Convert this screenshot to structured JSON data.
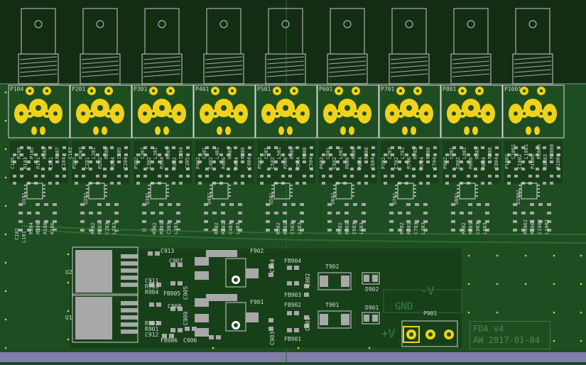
{
  "board": {
    "title_line1": "FDA v4",
    "title_line2": "AW 2017-01-04",
    "colors": {
      "background": "#132c14",
      "board": "#1e4d21",
      "copper_fill": "#174019",
      "pad": "#f0d21a",
      "smd_pad": "#a8a8a8",
      "silkscreen": "#e6e6e6",
      "edge": "#ffe600"
    }
  },
  "connectors": [
    {
      "label": "P104"
    },
    {
      "label": "P201"
    },
    {
      "label": "P301"
    },
    {
      "label": "P401"
    },
    {
      "label": "P501"
    },
    {
      "label": "P601"
    },
    {
      "label": "P701"
    },
    {
      "label": "P801"
    },
    {
      "label": "P1001"
    }
  ],
  "channels": [
    {
      "cols": [
        "C105",
        "R105",
        "R103",
        "P105",
        "R101",
        "R102",
        "C101",
        "R107",
        "C104",
        "C103"
      ],
      "u": "U101",
      "bottom": [
        "R104",
        "R109",
        "R108",
        "R106"
      ],
      "low": [
        "C102",
        "L101"
      ]
    },
    {
      "cols": [
        "P202",
        "R203",
        "C201",
        "L201",
        "R202",
        "R206",
        "R204",
        "C205",
        "C204"
      ],
      "u": "U201",
      "bottom": [
        "R202",
        "R201",
        "C203",
        "L203"
      ],
      "low": []
    },
    {
      "cols": [
        "P302",
        "C301",
        "C302",
        "L301",
        "R304",
        "R305",
        "R302",
        "C304",
        "C305"
      ],
      "u": "U301",
      "bottom": [
        "R302",
        "R301",
        "C303",
        "L303"
      ],
      "low": []
    },
    {
      "cols": [
        "P402",
        "C401",
        "C402",
        "L401",
        "R406",
        "R405",
        "R404",
        "R408",
        "C404"
      ],
      "u": "U401",
      "bottom": [
        "R402",
        "R401",
        "C403",
        "L403"
      ],
      "low": []
    },
    {
      "cols": [
        "P502",
        "C501",
        "C502",
        "L501",
        "R506",
        "R505",
        "R504",
        "R508",
        "C504"
      ],
      "u": "U501",
      "bottom": [
        "R502",
        "R501",
        "C503",
        "L503"
      ],
      "low": []
    },
    {
      "cols": [
        "P602",
        "C601",
        "C602",
        "L601",
        "R606",
        "R605",
        "R604",
        "R608",
        "C604"
      ],
      "u": "U601",
      "bottom": [
        "R602",
        "R601",
        "C603",
        "L603"
      ],
      "low": []
    },
    {
      "cols": [
        "P702",
        "C701",
        "C702",
        "L701",
        "R706",
        "R705",
        "R704",
        "R708",
        "C704"
      ],
      "u": "U701",
      "bottom": [
        "R702",
        "R701",
        "C703",
        "L703"
      ],
      "low": []
    },
    {
      "cols": [
        "P802",
        "C801",
        "C802",
        "L801",
        "R806",
        "R805",
        "R804",
        "R808",
        "C804"
      ],
      "u": "U801",
      "bottom": [
        "R802",
        "R801",
        "C803",
        "L803"
      ],
      "low": []
    },
    {
      "cols": [
        "P1002",
        "C1001",
        "C1002",
        "L1001",
        "R1006",
        "R1005",
        "R1003",
        "R1008",
        "R1004"
      ],
      "u": "U1001",
      "bottom": [
        "R1002",
        "R1001",
        "C1003",
        "L1002"
      ],
      "low": []
    }
  ],
  "power_labels": [
    {
      "t": "C913"
    },
    {
      "t": "C907"
    },
    {
      "t": "C911"
    },
    {
      "t": "R903"
    },
    {
      "t": "R904"
    },
    {
      "t": "FB905"
    },
    {
      "t": "C905"
    },
    {
      "t": "C908"
    },
    {
      "t": "R902"
    },
    {
      "t": "R901"
    },
    {
      "t": "C912"
    },
    {
      "t": "FB906"
    },
    {
      "t": "C906"
    },
    {
      "t": "C909"
    },
    {
      "t": "F902"
    },
    {
      "t": "F901"
    },
    {
      "t": "C904"
    },
    {
      "t": "C903"
    },
    {
      "t": "FB904"
    },
    {
      "t": "FB903"
    },
    {
      "t": "C902"
    },
    {
      "t": "FB902"
    },
    {
      "t": "FB901"
    },
    {
      "t": "C901"
    },
    {
      "t": "T902"
    },
    {
      "t": "T901"
    },
    {
      "t": "D902"
    },
    {
      "t": "D901"
    },
    {
      "t": "P901"
    },
    {
      "t": "U2"
    },
    {
      "t": "U1"
    }
  ],
  "silk_text": {
    "minus_v": "-V",
    "gnd": "GND",
    "plus_v": "+V"
  }
}
